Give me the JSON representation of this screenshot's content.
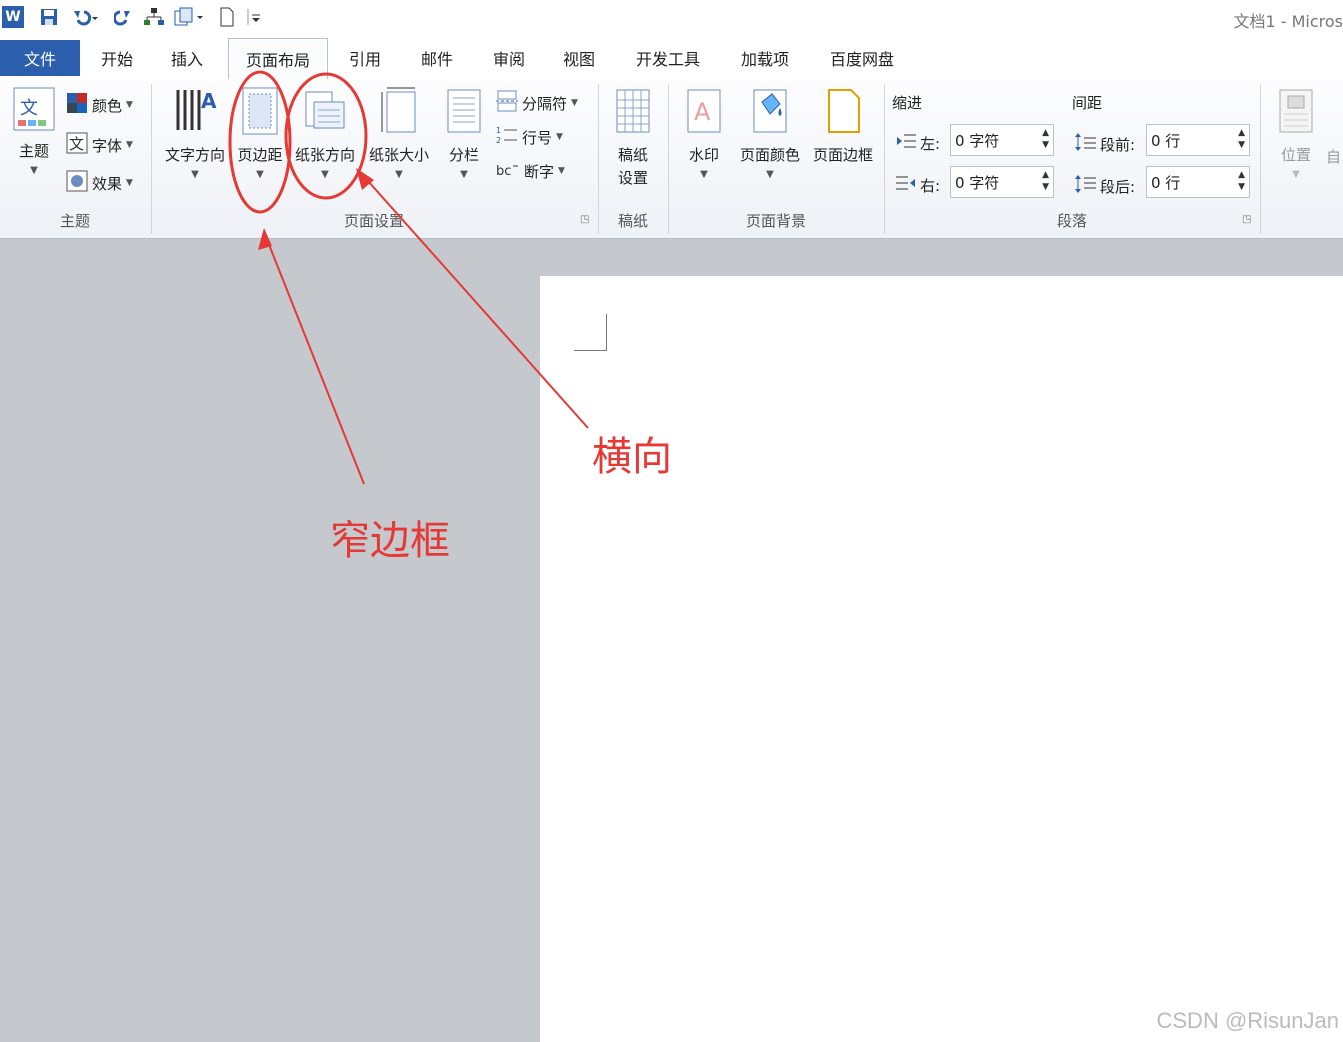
{
  "app": {
    "title": "文档1 - Micros"
  },
  "quick_access": {
    "icons": [
      "word-app-icon",
      "save-icon",
      "undo-icon",
      "redo-icon",
      "org-chart-icon",
      "copy-format-icon",
      "new-doc-icon",
      "customize-qat-icon"
    ]
  },
  "tabs": [
    {
      "label": "文件"
    },
    {
      "label": "开始"
    },
    {
      "label": "插入"
    },
    {
      "label": "页面布局"
    },
    {
      "label": "引用"
    },
    {
      "label": "邮件"
    },
    {
      "label": "审阅"
    },
    {
      "label": "视图"
    },
    {
      "label": "开发工具"
    },
    {
      "label": "加载项"
    },
    {
      "label": "百度网盘"
    }
  ],
  "ribbon": {
    "theme": {
      "group_label": "主题",
      "theme_btn": "主题",
      "colors": "颜色",
      "fonts": "字体",
      "effects": "效果"
    },
    "page_setup": {
      "group_label": "页面设置",
      "text_direction": "文字方向",
      "margins": "页边距",
      "orientation": "纸张方向",
      "size": "纸张大小",
      "columns": "分栏",
      "breaks": "分隔符",
      "line_numbers": "行号",
      "hyphenation": "断字"
    },
    "manuscript": {
      "group_label": "稿纸",
      "settings_line1": "稿纸",
      "settings_line2": "设置"
    },
    "background": {
      "group_label": "页面背景",
      "watermark": "水印",
      "page_color": "页面颜色",
      "page_borders": "页面边框"
    },
    "paragraph": {
      "group_label": "段落",
      "indent_label": "缩进",
      "spacing_label": "间距",
      "left_label": "左:",
      "right_label": "右:",
      "before_label": "段前:",
      "after_label": "段后:",
      "left_value": "0 字符",
      "right_value": "0 字符",
      "before_value": "0 行",
      "after_value": "0 行"
    },
    "arrange": {
      "position": "位置",
      "auto_wrap": "自"
    }
  },
  "annotations": {
    "narrow_margin": "窄边框",
    "landscape": "横向"
  },
  "watermark_text": "CSDN @RisunJan",
  "colors": {
    "accent": "#2b5ead",
    "annotation": "#e53935"
  }
}
